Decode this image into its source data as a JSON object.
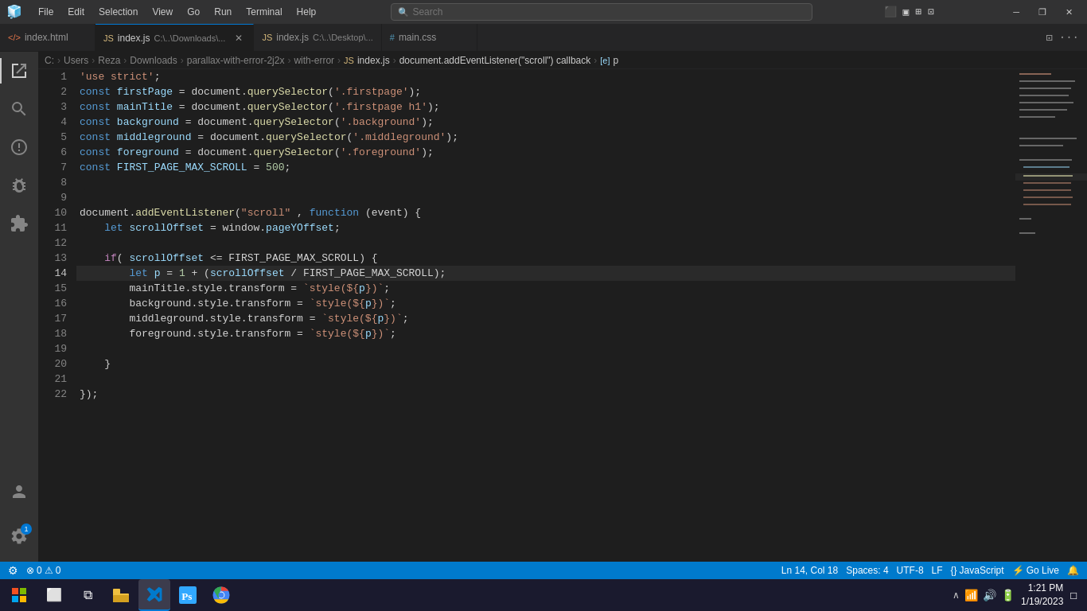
{
  "titlebar": {
    "menu_items": [
      "File",
      "Edit",
      "Selection",
      "View",
      "Go",
      "Run",
      "Terminal",
      "Help"
    ],
    "search_placeholder": "Search",
    "controls": [
      "⊟",
      "❐",
      "✕"
    ],
    "layout_icons": [
      "▣",
      "▤",
      "▦",
      "⊞"
    ]
  },
  "tabs": [
    {
      "id": "tab1",
      "icon_type": "html",
      "label": "index.html",
      "path": "",
      "closable": false,
      "active": false
    },
    {
      "id": "tab2",
      "icon_type": "js",
      "label": "index.js",
      "path": "C:\\..\\Downloads\\...",
      "closable": true,
      "active": true
    },
    {
      "id": "tab3",
      "icon_type": "js",
      "label": "index.js",
      "path": "C:\\..\\Desktop\\...",
      "closable": false,
      "active": false
    },
    {
      "id": "tab4",
      "icon_type": "css",
      "label": "main.css",
      "path": "",
      "closable": false,
      "active": false
    }
  ],
  "breadcrumb": {
    "parts": [
      "C:",
      "Users",
      "Reza",
      "Downloads",
      "parallax-with-error-2j2x",
      "with-error",
      "index.js",
      "document.addEventListener(\"scroll\") callback",
      "p"
    ]
  },
  "activity_bar": {
    "items": [
      "files",
      "search",
      "git",
      "debug",
      "extensions"
    ],
    "active": "files"
  },
  "code_lines": [
    {
      "num": 1,
      "tokens": [
        {
          "t": "str",
          "v": "'use strict'"
        },
        {
          "t": "punct",
          "v": ";"
        }
      ]
    },
    {
      "num": 2,
      "tokens": [
        {
          "t": "kw",
          "v": "const"
        },
        {
          "t": "op",
          "v": " firstPage "
        },
        {
          "t": "op",
          "v": "="
        },
        {
          "t": "op",
          "v": " document."
        },
        {
          "t": "method",
          "v": "querySelector"
        },
        {
          "t": "punct",
          "v": "("
        },
        {
          "t": "str",
          "v": "'.firstpage'"
        },
        {
          "t": "punct",
          "v": ");"
        }
      ]
    },
    {
      "num": 3,
      "tokens": [
        {
          "t": "kw",
          "v": "const"
        },
        {
          "t": "op",
          "v": " mainTitle "
        },
        {
          "t": "op",
          "v": "="
        },
        {
          "t": "op",
          "v": " document."
        },
        {
          "t": "method",
          "v": "querySelector"
        },
        {
          "t": "punct",
          "v": "("
        },
        {
          "t": "str",
          "v": "'.firstpage h1'"
        },
        {
          "t": "punct",
          "v": ");"
        }
      ]
    },
    {
      "num": 4,
      "tokens": [
        {
          "t": "kw",
          "v": "const"
        },
        {
          "t": "op",
          "v": " background "
        },
        {
          "t": "op",
          "v": "="
        },
        {
          "t": "op",
          "v": " document."
        },
        {
          "t": "method",
          "v": "querySelector"
        },
        {
          "t": "punct",
          "v": "("
        },
        {
          "t": "str",
          "v": "'.background'"
        },
        {
          "t": "punct",
          "v": ");"
        }
      ]
    },
    {
      "num": 5,
      "tokens": [
        {
          "t": "kw",
          "v": "const"
        },
        {
          "t": "op",
          "v": " middleground "
        },
        {
          "t": "op",
          "v": "="
        },
        {
          "t": "op",
          "v": " document."
        },
        {
          "t": "method",
          "v": "querySelector"
        },
        {
          "t": "punct",
          "v": "("
        },
        {
          "t": "str",
          "v": "'.middleground'"
        },
        {
          "t": "punct",
          "v": ");"
        }
      ]
    },
    {
      "num": 6,
      "tokens": [
        {
          "t": "kw",
          "v": "const"
        },
        {
          "t": "op",
          "v": " foreground "
        },
        {
          "t": "op",
          "v": "="
        },
        {
          "t": "op",
          "v": " document."
        },
        {
          "t": "method",
          "v": "querySelector"
        },
        {
          "t": "punct",
          "v": "("
        },
        {
          "t": "str",
          "v": "'.foreground'"
        },
        {
          "t": "punct",
          "v": ");"
        }
      ]
    },
    {
      "num": 7,
      "tokens": [
        {
          "t": "kw",
          "v": "const"
        },
        {
          "t": "op",
          "v": " FIRST_PAGE_MAX_SCROLL "
        },
        {
          "t": "op",
          "v": "="
        },
        {
          "t": "num",
          "v": " 500"
        },
        {
          "t": "punct",
          "v": ";"
        }
      ]
    },
    {
      "num": 8,
      "tokens": []
    },
    {
      "num": 9,
      "tokens": []
    },
    {
      "num": 10,
      "tokens": [
        {
          "t": "op",
          "v": "document."
        },
        {
          "t": "method",
          "v": "addEventListener"
        },
        {
          "t": "punct",
          "v": "("
        },
        {
          "t": "str",
          "v": "\"scroll\""
        },
        {
          "t": "op",
          "v": " , "
        },
        {
          "t": "kw",
          "v": "function"
        },
        {
          "t": "op",
          "v": " (event) {"
        }
      ]
    },
    {
      "num": 11,
      "tokens": [
        {
          "t": "op",
          "v": "    "
        },
        {
          "t": "kw",
          "v": "let"
        },
        {
          "t": "var",
          "v": " scrollOffset"
        },
        {
          "t": "op",
          "v": " = window."
        },
        {
          "t": "prop",
          "v": "pageYOffset"
        },
        {
          "t": "punct",
          "v": ";"
        }
      ]
    },
    {
      "num": 12,
      "tokens": []
    },
    {
      "num": 13,
      "tokens": [
        {
          "t": "op",
          "v": "    "
        },
        {
          "t": "kw2",
          "v": "if"
        },
        {
          "t": "punct",
          "v": "("
        },
        {
          "t": "var",
          "v": " scrollOffset"
        },
        {
          "t": "op",
          "v": " <= FIRST_PAGE_MAX_SCROLL) {"
        }
      ]
    },
    {
      "num": 14,
      "tokens": [
        {
          "t": "op",
          "v": "        "
        },
        {
          "t": "kw",
          "v": "let"
        },
        {
          "t": "var",
          "v": " p"
        },
        {
          "t": "op",
          "v": " = "
        },
        {
          "t": "num",
          "v": "1"
        },
        {
          "t": "op",
          "v": " + ("
        },
        {
          "t": "var",
          "v": "scrollOffset"
        },
        {
          "t": "op",
          "v": " / FIRST_PAGE_MAX_SCROLL"
        },
        {
          "t": "punct",
          "v": "});"
        }
      ],
      "active": true
    },
    {
      "num": 15,
      "tokens": [
        {
          "t": "op",
          "v": "        mainTitle.style.transform = "
        },
        {
          "t": "tmpl",
          "v": "`style(${"
        },
        {
          "t": "var",
          "v": "p"
        },
        {
          "t": "tmpl",
          "v": "})`"
        },
        {
          "t": "punct",
          "v": ";"
        }
      ]
    },
    {
      "num": 16,
      "tokens": [
        {
          "t": "op",
          "v": "        background.style.transform = "
        },
        {
          "t": "tmpl",
          "v": "`style(${"
        },
        {
          "t": "var",
          "v": "p"
        },
        {
          "t": "tmpl",
          "v": "})`"
        },
        {
          "t": "punct",
          "v": ";"
        }
      ]
    },
    {
      "num": 17,
      "tokens": [
        {
          "t": "op",
          "v": "        middleground.style.transform = "
        },
        {
          "t": "tmpl",
          "v": "`style(${"
        },
        {
          "t": "var",
          "v": "p"
        },
        {
          "t": "tmpl",
          "v": "})`"
        },
        {
          "t": "punct",
          "v": ";"
        }
      ]
    },
    {
      "num": 18,
      "tokens": [
        {
          "t": "op",
          "v": "        foreground.style.transform = "
        },
        {
          "t": "tmpl",
          "v": "`style(${"
        },
        {
          "t": "var",
          "v": "p"
        },
        {
          "t": "tmpl",
          "v": "})`"
        },
        {
          "t": "punct",
          "v": ";"
        }
      ]
    },
    {
      "num": 19,
      "tokens": []
    },
    {
      "num": 20,
      "tokens": [
        {
          "t": "op",
          "v": "    }"
        }
      ]
    },
    {
      "num": 21,
      "tokens": []
    },
    {
      "num": 22,
      "tokens": [
        {
          "t": "punct",
          "v": "});"
        }
      ]
    }
  ],
  "statusbar": {
    "errors": "0",
    "warnings": "0",
    "line": "Ln 14, Col 18",
    "spaces": "Spaces: 4",
    "encoding": "UTF-8",
    "eol": "LF",
    "language": "JavaScript",
    "golive": "Go Live"
  },
  "taskbar": {
    "time": "1:21 PM",
    "date": "1/19/2023"
  }
}
